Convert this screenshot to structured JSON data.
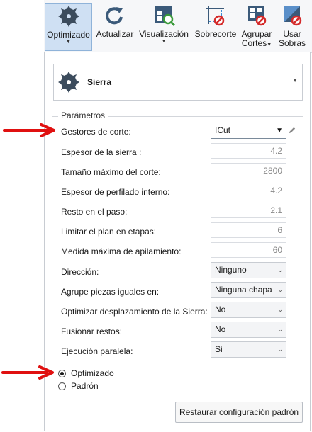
{
  "toolbar": {
    "items": [
      {
        "label": "Optimizado",
        "icon": "saw-blade-icon",
        "dropdown": true,
        "active": true
      },
      {
        "label": "Actualizar",
        "icon": "refresh-icon"
      },
      {
        "label": "Visualización",
        "icon": "visualization-icon",
        "dropdown": true
      },
      {
        "label": "Sobrecorte",
        "icon": "overcut-icon"
      },
      {
        "label": "Agrupar",
        "label2": "Cortes",
        "icon": "group-cuts-icon",
        "dropdown": true
      },
      {
        "label": "Usar",
        "label2": "Sobras",
        "icon": "use-leftovers-icon"
      }
    ]
  },
  "tool": {
    "name": "Sierra",
    "icon": "saw-blade-icon"
  },
  "params": {
    "legend": "Parámetros",
    "cutting_manager": {
      "label": "Gestores de corte:",
      "value": "ICut"
    },
    "rows": [
      {
        "label": "Espesor de la sierra :",
        "value": "4.2"
      },
      {
        "label": "Tamaño máximo del corte:",
        "value": "2800"
      },
      {
        "label": "Espesor de perfilado interno:",
        "value": "4.2"
      },
      {
        "label": "Resto en el paso:",
        "value": "2.1"
      },
      {
        "label": "Limitar el plan en etapas:",
        "value": "6"
      },
      {
        "label": "Medida máxima de apilamiento:",
        "value": "60"
      }
    ],
    "combos": [
      {
        "label": "Dirección:",
        "value": "Ninguno"
      },
      {
        "label": "Agrupe piezas iguales en:",
        "value": "Ninguna chapa"
      },
      {
        "label": "Optimizar desplazamiento de la Sierra:",
        "value": "No"
      },
      {
        "label": "Fusionar restos:",
        "value": "No"
      },
      {
        "label": "Ejecución paralela:",
        "value": "Si"
      }
    ]
  },
  "mode": {
    "options": [
      {
        "label": "Optimizado",
        "selected": true
      },
      {
        "label": "Padrón",
        "selected": false
      }
    ]
  },
  "restore_label": "Restaurar configuración padrón",
  "colors": {
    "arrow": "#e01010",
    "accent_active": "#cfe0f3",
    "icon_blue": "#3b5a7a",
    "icon_red": "#d42a2a"
  }
}
